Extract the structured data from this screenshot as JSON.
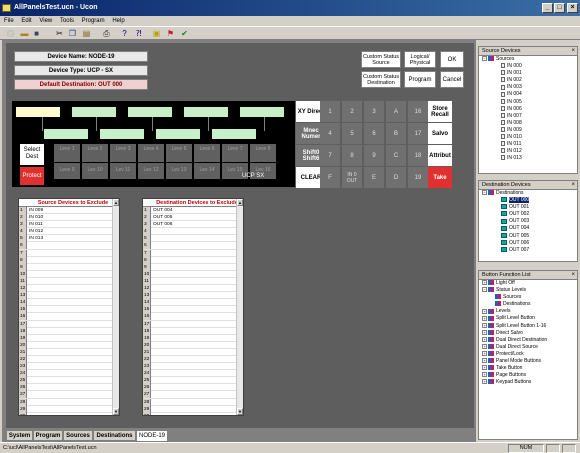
{
  "window": {
    "title": "AllPanelsTest.ucn - Ucon"
  },
  "menu": [
    "File",
    "Edit",
    "View",
    "Tools",
    "Program",
    "Help"
  ],
  "toolbar_icons": [
    "new-icon",
    "open-icon",
    "save-icon",
    "cut-icon",
    "copy-icon",
    "paste-icon",
    "print-icon",
    "help-icon",
    "context-help-icon",
    "note-icon",
    "flag-icon",
    "check-icon"
  ],
  "device": {
    "name": "Device Name: NODE-19",
    "type": "Device Type: UCP - SX",
    "default_dest": "Default Destination: OUT  000"
  },
  "action_buttons": {
    "custom_status_source": "Custom Status Source",
    "logical_physical": "Logical/ Physical",
    "ok": "OK",
    "custom_status_destination": "Custom Status Destination",
    "program": "Program",
    "cancel": "Cancel"
  },
  "panel": {
    "select_dest": "Select Dest",
    "protect": "Protect",
    "model": "UCP SX",
    "levels": [
      "Leve 1",
      "Leve 2",
      "Leve 3",
      "Leve 4",
      "Leve 5",
      "Leve 6",
      "Leve 7",
      "Leve 8",
      "Leve 9",
      "Lev 10",
      "Lev 11",
      "Lev 12",
      "Lev 13",
      "Lev 14",
      "Lev 15",
      "Lev 16"
    ],
    "keypad": [
      [
        "XY Direct",
        "1",
        "2",
        "3",
        "A",
        "16",
        "Store Recall"
      ],
      [
        "Mnec Numer",
        "4",
        "5",
        "6",
        "B",
        "17",
        "Salvo"
      ],
      [
        "Shift0 Shift6",
        "7",
        "8",
        "9",
        "C",
        "18",
        "Attribut"
      ],
      [
        "CLEAR",
        "F",
        "IN 0 OUT",
        "E",
        "D",
        "19",
        "Take"
      ]
    ]
  },
  "source_list": {
    "title": "Source Devices to Exclude",
    "rows": [
      "IN  009",
      "IN  010",
      "IN  011",
      "IN  012",
      "IN  013"
    ],
    "row_count": 37
  },
  "dest_list": {
    "title": "Destination Devices to Exclude",
    "rows": [
      "OUT  004",
      "OUT  005",
      "OUT  006"
    ],
    "row_count": 37
  },
  "tabs": [
    "System",
    "Program",
    "Sources",
    "Destinations",
    "NODE-19"
  ],
  "statusbar": {
    "path": "C:\\ucl\\AllPanelsTest\\AllPanelsTest.ucn",
    "num": "NUM"
  },
  "source_dock": {
    "title": "Source Devices",
    "root": "Sources",
    "items": [
      "IN  000",
      "IN  001",
      "IN  002",
      "IN  003",
      "IN  004",
      "IN  005",
      "IN  006",
      "IN  007",
      "IN  008",
      "IN  009",
      "IN  010",
      "IN  011",
      "IN  012",
      "IN  013"
    ]
  },
  "dest_dock": {
    "title": "Destination Devices",
    "root": "Destinations",
    "items": [
      "OUT  000",
      "OUT  001",
      "OUT  002",
      "OUT  003",
      "OUT  004",
      "OUT  005",
      "OUT  006",
      "OUT  007"
    ]
  },
  "button_dock": {
    "title": "Button Function List",
    "items": [
      "Light Off",
      "Status Levels",
      "Sources",
      "Destinations",
      "Levels",
      "Split Level Button",
      "Split Level Button 1-16",
      "Direct Salvo",
      "Dual Direct Destination",
      "Dual Direct Source",
      "Protect/Lock",
      "Panel Mode Buttons",
      "Take Button",
      "Page Buttons",
      "Keypad Buttons"
    ]
  },
  "colors": {
    "title_start": "#0a246a",
    "protect": "#e03030",
    "take": "#e03030",
    "level": "#c8f0c8",
    "list_title": "#c00000",
    "selected": "#0a246a"
  }
}
